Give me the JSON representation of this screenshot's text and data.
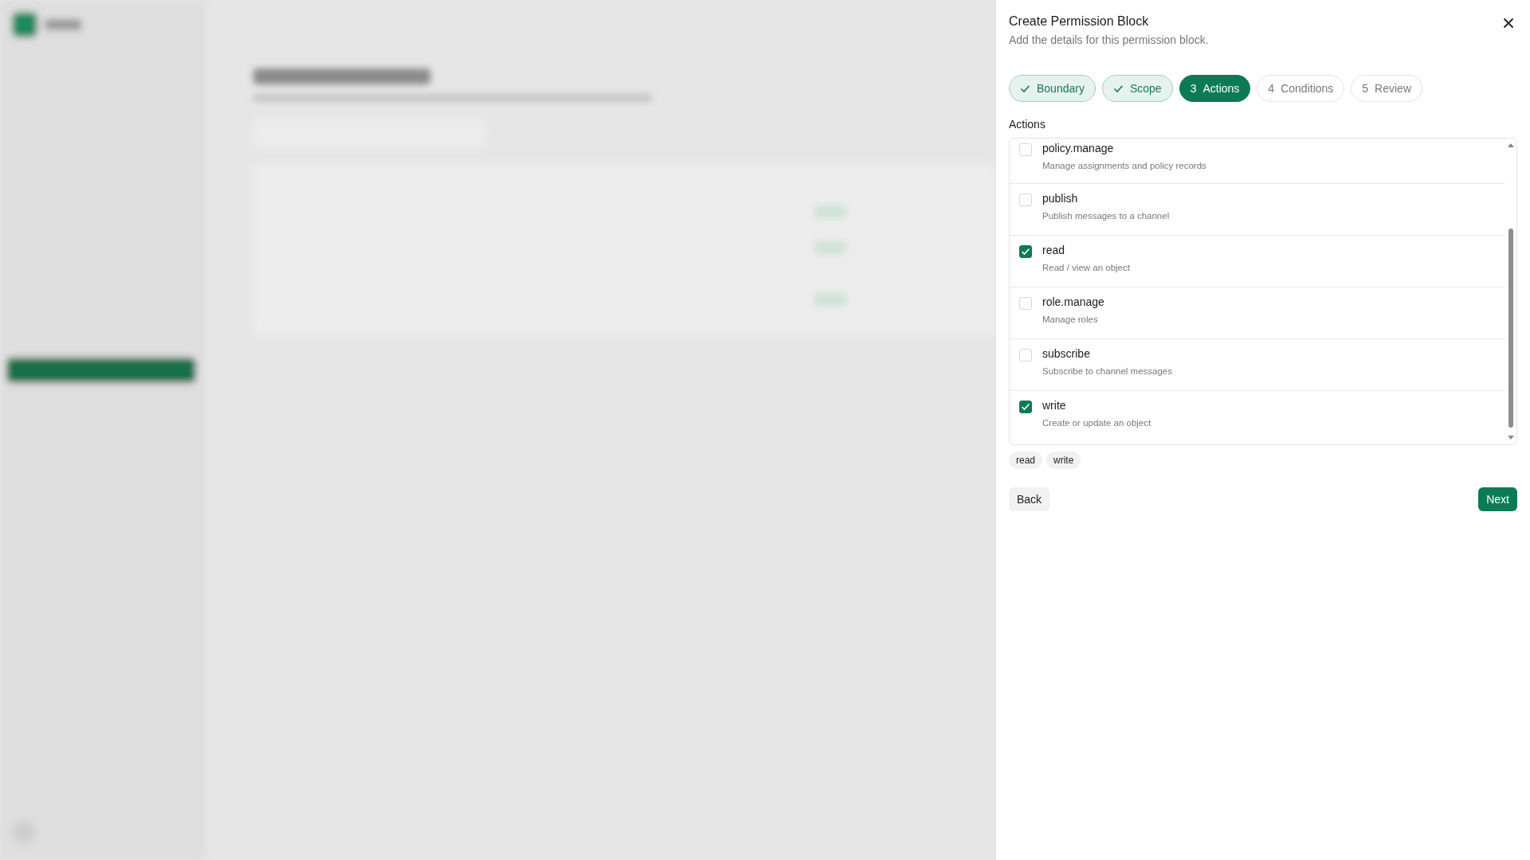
{
  "dialog": {
    "title": "Create Permission Block",
    "subtitle": "Add the details for this permission block.",
    "steps": [
      {
        "label": "Boundary",
        "kind": "done"
      },
      {
        "label": "Scope",
        "kind": "done"
      },
      {
        "number": "3",
        "label": "Actions",
        "kind": "current"
      },
      {
        "number": "4",
        "label": "Conditions",
        "kind": "pending"
      },
      {
        "number": "5",
        "label": "Review",
        "kind": "pending"
      }
    ],
    "section_label": "Actions",
    "actions": [
      {
        "name": "policy.manage",
        "description": "Manage assignments and policy records",
        "checked": false
      },
      {
        "name": "publish",
        "description": "Publish messages to a channel",
        "checked": false
      },
      {
        "name": "read",
        "description": "Read / view an object",
        "checked": true
      },
      {
        "name": "role.manage",
        "description": "Manage roles",
        "checked": false
      },
      {
        "name": "subscribe",
        "description": "Subscribe to channel messages",
        "checked": false
      },
      {
        "name": "write",
        "description": "Create or update an object",
        "checked": true
      }
    ],
    "chips": [
      "read",
      "write"
    ],
    "back_button": "Back",
    "next_button": "Next"
  }
}
